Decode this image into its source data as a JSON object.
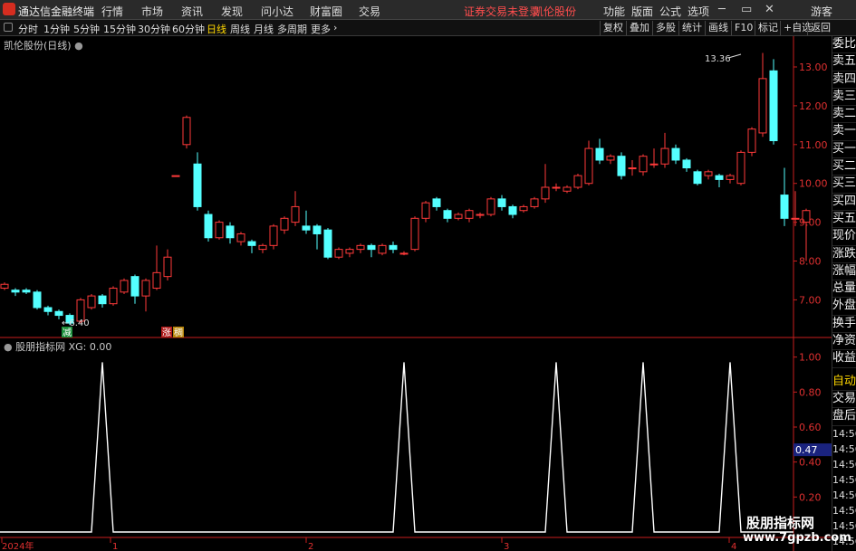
{
  "app": {
    "title": "通达信金融终端"
  },
  "menu": [
    "行情",
    "市场",
    "资讯",
    "发现",
    "问小达",
    "财富圈",
    "交易"
  ],
  "login_notice": "证券交易未登录",
  "stock_name": "凯伦股份",
  "right_menu": [
    "功能",
    "版面",
    "公式",
    "选项"
  ],
  "guest": "游客",
  "periods": [
    "分时",
    "1分钟",
    "5分钟",
    "15分钟",
    "30分钟",
    "60分钟",
    "日线",
    "周线",
    "月线",
    "多周期",
    "更多"
  ],
  "active_period": "日线",
  "tools": [
    "复权",
    "叠加",
    "多股",
    "统计",
    "画线",
    "F10",
    "标记",
    "+自选",
    "返回"
  ],
  "chart_title": "凯伦股份(日线)",
  "price_axis": [
    "13.00",
    "12.00",
    "11.00",
    "10.00",
    "9.00",
    "8.00",
    "7.00"
  ],
  "high_label": "13.36",
  "low_label": "6.40",
  "tags": {
    "jian": "减",
    "zhang": "涨",
    "chou": "稠"
  },
  "indicator_title": "股朋指标网 XG: 0.00",
  "ind_axis": [
    "1.00",
    "0.80",
    "0.60",
    "0.40",
    "0.20"
  ],
  "ind_value": "0.47",
  "date_axis": [
    "2024年",
    "1",
    "2",
    "3",
    "4"
  ],
  "right_panel": [
    "委比",
    "卖五",
    "卖四",
    "卖三",
    "卖二",
    "卖一",
    "买一",
    "买二",
    "买三",
    "买四",
    "买五",
    "现价",
    "涨跌",
    "涨幅",
    "总量",
    "外盘",
    "换手",
    "净资",
    "收益"
  ],
  "right_panel2": [
    "自动",
    "交易",
    "盘后"
  ],
  "times": [
    "14:56",
    "14:56",
    "14:56",
    "14:56",
    "14:56",
    "14:56",
    "14:56",
    "14:56",
    "14:56"
  ],
  "watermark": {
    "line1": "股朋指标网",
    "line2": "www.7gpzb.com"
  },
  "colors": {
    "up": "#ff3a3a",
    "down": "#54ffff",
    "axis": "#c81e1e",
    "active": "#ffd700"
  },
  "chart_data": {
    "type": "candlestick",
    "candles": [
      {
        "o": 7.3,
        "c": 7.4,
        "h": 7.45,
        "l": 7.25
      },
      {
        "o": 7.25,
        "c": 7.2,
        "h": 7.3,
        "l": 7.1
      },
      {
        "o": 7.25,
        "c": 7.2,
        "h": 7.3,
        "l": 7.15
      },
      {
        "o": 7.2,
        "c": 6.8,
        "h": 7.25,
        "l": 6.75
      },
      {
        "o": 6.8,
        "c": 6.7,
        "h": 6.85,
        "l": 6.6
      },
      {
        "o": 6.7,
        "c": 6.6,
        "h": 6.75,
        "l": 6.5
      },
      {
        "o": 6.6,
        "c": 6.4,
        "h": 6.65,
        "l": 6.35
      },
      {
        "o": 6.45,
        "c": 7.0,
        "h": 7.05,
        "l": 6.4
      },
      {
        "o": 6.8,
        "c": 7.1,
        "h": 7.15,
        "l": 6.75
      },
      {
        "o": 7.1,
        "c": 6.9,
        "h": 7.15,
        "l": 6.8
      },
      {
        "o": 6.9,
        "c": 7.3,
        "h": 7.35,
        "l": 6.85
      },
      {
        "o": 7.2,
        "c": 7.5,
        "h": 7.55,
        "l": 7.15
      },
      {
        "o": 7.6,
        "c": 7.1,
        "h": 7.65,
        "l": 6.9
      },
      {
        "o": 7.1,
        "c": 7.5,
        "h": 7.55,
        "l": 6.7
      },
      {
        "o": 7.3,
        "c": 7.7,
        "h": 8.4,
        "l": 7.25
      },
      {
        "o": 7.6,
        "c": 8.1,
        "h": 8.3,
        "l": 7.5
      },
      {
        "o": 10.2,
        "c": 10.2,
        "h": 10.2,
        "l": 10.2
      },
      {
        "o": 11.0,
        "c": 11.7,
        "h": 11.75,
        "l": 10.9
      },
      {
        "o": 10.5,
        "c": 9.4,
        "h": 10.8,
        "l": 9.3
      },
      {
        "o": 9.2,
        "c": 8.6,
        "h": 9.3,
        "l": 8.5
      },
      {
        "o": 8.6,
        "c": 9.0,
        "h": 9.05,
        "l": 8.55
      },
      {
        "o": 8.9,
        "c": 8.6,
        "h": 9.0,
        "l": 8.45
      },
      {
        "o": 8.5,
        "c": 8.7,
        "h": 8.75,
        "l": 8.4
      },
      {
        "o": 8.5,
        "c": 8.4,
        "h": 8.55,
        "l": 8.2
      },
      {
        "o": 8.3,
        "c": 8.4,
        "h": 8.45,
        "l": 8.2
      },
      {
        "o": 8.4,
        "c": 8.9,
        "h": 8.95,
        "l": 8.3
      },
      {
        "o": 8.8,
        "c": 9.1,
        "h": 9.15,
        "l": 8.7
      },
      {
        "o": 9.0,
        "c": 9.4,
        "h": 9.8,
        "l": 8.9
      },
      {
        "o": 8.9,
        "c": 8.8,
        "h": 9.3,
        "l": 8.7
      },
      {
        "o": 8.9,
        "c": 8.7,
        "h": 8.95,
        "l": 8.3
      },
      {
        "o": 8.8,
        "c": 8.1,
        "h": 8.85,
        "l": 8.05
      },
      {
        "o": 8.1,
        "c": 8.3,
        "h": 8.35,
        "l": 8.05
      },
      {
        "o": 8.2,
        "c": 8.3,
        "h": 8.35,
        "l": 8.1
      },
      {
        "o": 8.3,
        "c": 8.4,
        "h": 8.45,
        "l": 8.2
      },
      {
        "o": 8.4,
        "c": 8.3,
        "h": 8.45,
        "l": 8.1
      },
      {
        "o": 8.2,
        "c": 8.4,
        "h": 8.45,
        "l": 8.15
      },
      {
        "o": 8.4,
        "c": 8.3,
        "h": 8.5,
        "l": 8.2
      },
      {
        "o": 8.2,
        "c": 8.2,
        "h": 8.25,
        "l": 8.15
      },
      {
        "o": 8.3,
        "c": 9.1,
        "h": 9.15,
        "l": 8.25
      },
      {
        "o": 9.1,
        "c": 9.5,
        "h": 9.55,
        "l": 9.0
      },
      {
        "o": 9.6,
        "c": 9.4,
        "h": 9.65,
        "l": 9.3
      },
      {
        "o": 9.3,
        "c": 9.1,
        "h": 9.35,
        "l": 9.0
      },
      {
        "o": 9.1,
        "c": 9.2,
        "h": 9.25,
        "l": 9.05
      },
      {
        "o": 9.1,
        "c": 9.3,
        "h": 9.35,
        "l": 9.0
      },
      {
        "o": 9.2,
        "c": 9.2,
        "h": 9.25,
        "l": 9.1
      },
      {
        "o": 9.2,
        "c": 9.6,
        "h": 9.65,
        "l": 9.15
      },
      {
        "o": 9.6,
        "c": 9.4,
        "h": 9.7,
        "l": 9.3
      },
      {
        "o": 9.4,
        "c": 9.2,
        "h": 9.45,
        "l": 9.1
      },
      {
        "o": 9.3,
        "c": 9.4,
        "h": 9.45,
        "l": 9.25
      },
      {
        "o": 9.4,
        "c": 9.6,
        "h": 9.65,
        "l": 9.35
      },
      {
        "o": 9.6,
        "c": 9.9,
        "h": 10.5,
        "l": 9.5
      },
      {
        "o": 9.9,
        "c": 9.9,
        "h": 10.0,
        "l": 9.8
      },
      {
        "o": 9.8,
        "c": 9.9,
        "h": 9.95,
        "l": 9.75
      },
      {
        "o": 9.9,
        "c": 10.2,
        "h": 10.25,
        "l": 9.85
      },
      {
        "o": 10.0,
        "c": 10.9,
        "h": 11.1,
        "l": 9.95
      },
      {
        "o": 10.9,
        "c": 10.6,
        "h": 11.15,
        "l": 10.5
      },
      {
        "o": 10.6,
        "c": 10.7,
        "h": 10.75,
        "l": 10.5
      },
      {
        "o": 10.7,
        "c": 10.2,
        "h": 10.8,
        "l": 10.1
      },
      {
        "o": 10.4,
        "c": 10.4,
        "h": 10.6,
        "l": 10.2
      },
      {
        "o": 10.3,
        "c": 10.7,
        "h": 10.75,
        "l": 10.2
      },
      {
        "o": 10.5,
        "c": 10.5,
        "h": 10.9,
        "l": 10.4
      },
      {
        "o": 10.5,
        "c": 10.9,
        "h": 11.3,
        "l": 10.4
      },
      {
        "o": 10.9,
        "c": 10.6,
        "h": 11.0,
        "l": 10.5
      },
      {
        "o": 10.6,
        "c": 10.4,
        "h": 10.65,
        "l": 10.3
      },
      {
        "o": 10.3,
        "c": 10.0,
        "h": 10.35,
        "l": 9.95
      },
      {
        "o": 10.2,
        "c": 10.3,
        "h": 10.35,
        "l": 10.1
      },
      {
        "o": 10.2,
        "c": 10.1,
        "h": 10.25,
        "l": 9.9
      },
      {
        "o": 10.1,
        "c": 10.2,
        "h": 10.25,
        "l": 10.0
      },
      {
        "o": 10.0,
        "c": 10.8,
        "h": 10.85,
        "l": 9.95
      },
      {
        "o": 10.8,
        "c": 11.4,
        "h": 11.45,
        "l": 10.7
      },
      {
        "o": 11.3,
        "c": 12.7,
        "h": 13.36,
        "l": 11.2
      },
      {
        "o": 12.9,
        "c": 11.1,
        "h": 13.2,
        "l": 11.0
      },
      {
        "o": 9.7,
        "c": 9.1,
        "h": 10.4,
        "l": 8.9
      },
      {
        "o": 9.1,
        "c": 9.1,
        "h": 9.8,
        "l": 8.9
      },
      {
        "o": 9.0,
        "c": 9.3,
        "h": 9.35,
        "l": 8.0
      }
    ],
    "signals": [
      0.97,
      0.97,
      0.97,
      0.97,
      0.97
    ],
    "ind_range": [
      0,
      1.05
    ]
  }
}
